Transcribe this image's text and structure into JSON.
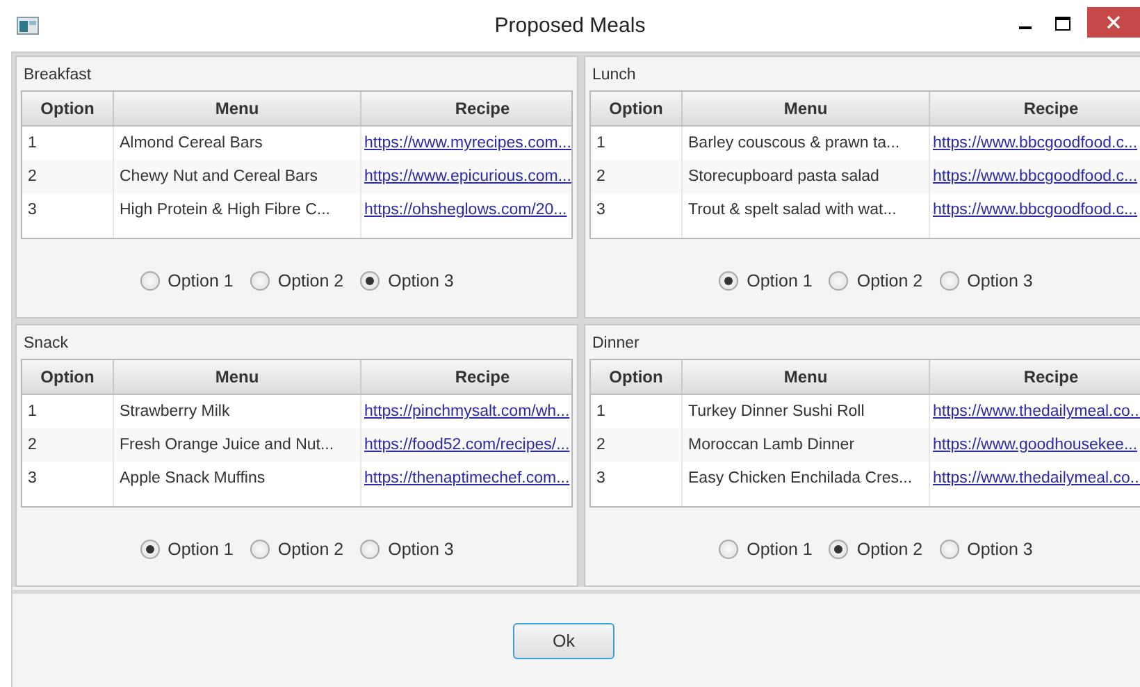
{
  "window": {
    "title": "Proposed Meals"
  },
  "panels": [
    {
      "title": "Breakfast",
      "columns": [
        "Option",
        "Menu",
        "Recipe"
      ],
      "rows": [
        {
          "option": "1",
          "menu": "Almond Cereal Bars",
          "recipe": "https://www.myrecipes.com..."
        },
        {
          "option": "2",
          "menu": "Chewy Nut and Cereal Bars",
          "recipe": "https://www.epicurious.com..."
        },
        {
          "option": "3",
          "menu": "High Protein & High Fibre C...",
          "recipe": "https://ohsheglows.com/20..."
        }
      ],
      "options": [
        {
          "label": "Option 1",
          "selected": false
        },
        {
          "label": "Option 2",
          "selected": false
        },
        {
          "label": "Option 3",
          "selected": true
        }
      ]
    },
    {
      "title": "Lunch",
      "columns": [
        "Option",
        "Menu",
        "Recipe"
      ],
      "rows": [
        {
          "option": "1",
          "menu": "Barley couscous & prawn ta...",
          "recipe": "https://www.bbcgoodfood.c..."
        },
        {
          "option": "2",
          "menu": "Storecupboard pasta salad",
          "recipe": "https://www.bbcgoodfood.c..."
        },
        {
          "option": "3",
          "menu": "Trout & spelt salad with wat...",
          "recipe": "https://www.bbcgoodfood.c..."
        }
      ],
      "options": [
        {
          "label": "Option 1",
          "selected": true
        },
        {
          "label": "Option 2",
          "selected": false
        },
        {
          "label": "Option 3",
          "selected": false
        }
      ]
    },
    {
      "title": "Snack",
      "columns": [
        "Option",
        "Menu",
        "Recipe"
      ],
      "rows": [
        {
          "option": "1",
          "menu": "Strawberry Milk",
          "recipe": "https://pinchmysalt.com/wh..."
        },
        {
          "option": "2",
          "menu": "Fresh Orange Juice and Nut...",
          "recipe": "https://food52.com/recipes/..."
        },
        {
          "option": "3",
          "menu": "Apple Snack Muffins",
          "recipe": "https://thenaptimechef.com..."
        }
      ],
      "options": [
        {
          "label": "Option 1",
          "selected": true
        },
        {
          "label": "Option 2",
          "selected": false
        },
        {
          "label": "Option 3",
          "selected": false
        }
      ]
    },
    {
      "title": "Dinner",
      "columns": [
        "Option",
        "Menu",
        "Recipe"
      ],
      "rows": [
        {
          "option": "1",
          "menu": "Turkey Dinner Sushi Roll",
          "recipe": "https://www.thedailymeal.co..."
        },
        {
          "option": "2",
          "menu": "Moroccan Lamb Dinner",
          "recipe": "https://www.goodhousekee..."
        },
        {
          "option": "3",
          "menu": "Easy Chicken Enchilada Cres...",
          "recipe": "https://www.thedailymeal.co..."
        }
      ],
      "options": [
        {
          "label": "Option 1",
          "selected": false
        },
        {
          "label": "Option 2",
          "selected": true
        },
        {
          "label": "Option 3",
          "selected": false
        }
      ]
    }
  ],
  "ok_button": "Ok"
}
